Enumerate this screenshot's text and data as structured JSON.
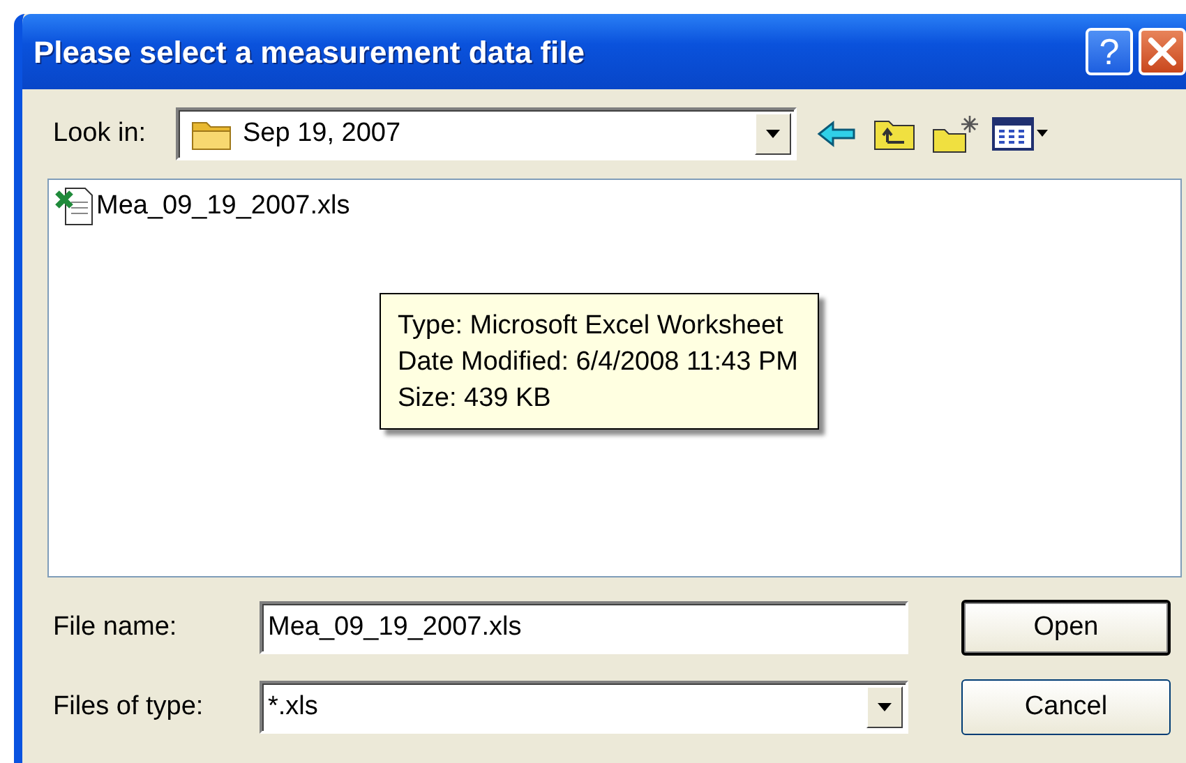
{
  "window": {
    "title": "Please select a measurement data file",
    "help_button": "?"
  },
  "look_in": {
    "label": "Look in:",
    "value": "Sep 19, 2007"
  },
  "files": [
    {
      "name": "Mea_09_19_2007.xls"
    }
  ],
  "tooltip": {
    "lines": [
      "Type: Microsoft Excel Worksheet",
      "Date Modified: 6/4/2008 11:43 PM",
      "Size: 439 KB"
    ]
  },
  "file_name": {
    "label": "File name:",
    "value": "Mea_09_19_2007.xls"
  },
  "file_type": {
    "label": "Files of type:",
    "value": "*.xls"
  },
  "buttons": [
    {
      "label": "Open",
      "default": true
    },
    {
      "label": "Cancel",
      "default": false
    }
  ]
}
